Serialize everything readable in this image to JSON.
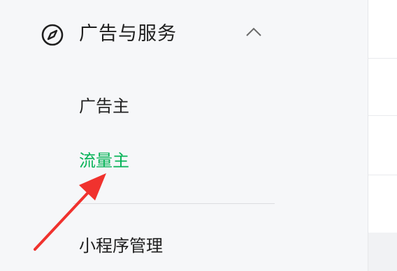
{
  "sidebar": {
    "section": {
      "title": "广告与服务",
      "icon": "compass-icon",
      "toggle_icon": "chevron-up-icon",
      "expanded": true
    },
    "items": [
      {
        "label": "广告主",
        "active": false
      },
      {
        "label": "流量主",
        "active": true
      },
      {
        "label": "小程序管理",
        "active": false
      }
    ]
  },
  "colors": {
    "active": "#07b358",
    "annotation_arrow": "#f0322e",
    "sidebar_bg": "#f6f7f9",
    "text": "#1f1f1f"
  }
}
